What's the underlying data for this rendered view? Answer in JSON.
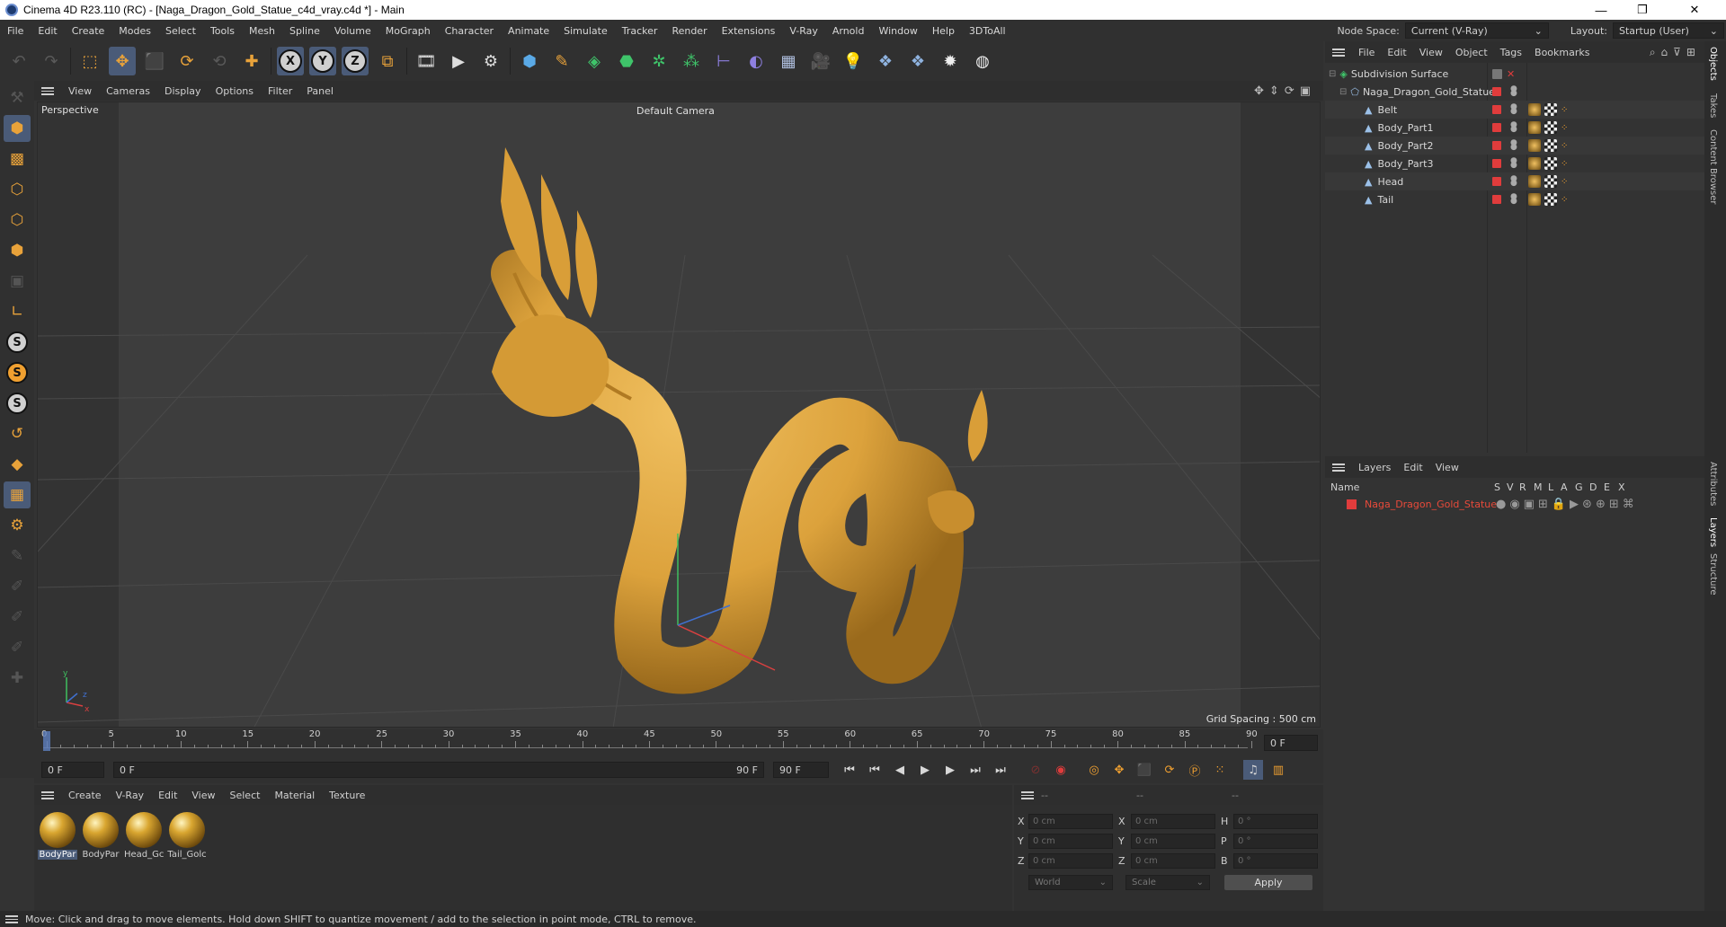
{
  "window": {
    "title": "Cinema 4D R23.110 (RC) - [Naga_Dragon_Gold_Statue_c4d_vray.c4d *] - Main",
    "minimize": "—",
    "maximize": "❐",
    "close": "✕"
  },
  "menu": [
    "File",
    "Edit",
    "Create",
    "Modes",
    "Select",
    "Tools",
    "Mesh",
    "Spline",
    "Volume",
    "MoGraph",
    "Character",
    "Animate",
    "Simulate",
    "Tracker",
    "Render",
    "Extensions",
    "V-Ray",
    "Arnold",
    "Window",
    "Help",
    "3DToAll"
  ],
  "node_space": {
    "label": "Node Space:",
    "value": "Current (V-Ray)"
  },
  "layout": {
    "label": "Layout:",
    "value": "Startup (User)"
  },
  "viewport_menu": [
    "View",
    "Cameras",
    "Display",
    "Options",
    "Filter",
    "Panel"
  ],
  "viewport": {
    "name": "Perspective",
    "camera": "Default Camera",
    "grid_spacing": "Grid Spacing : 500 cm"
  },
  "timeline": {
    "ticks": [
      "0",
      "5",
      "10",
      "15",
      "20",
      "25",
      "30",
      "35",
      "40",
      "45",
      "50",
      "55",
      "60",
      "65",
      "70",
      "75",
      "80",
      "85",
      "90"
    ],
    "current": "0 F"
  },
  "transport": {
    "start": "0 F",
    "range_start": "0 F",
    "range_end": "90 F",
    "end": "90 F"
  },
  "materials_menu": [
    "Create",
    "V-Ray",
    "Edit",
    "View",
    "Select",
    "Material",
    "Texture"
  ],
  "materials": [
    "BodyPar",
    "BodyPar",
    "Head_Gc",
    "Tail_Golc"
  ],
  "coords": {
    "header": [
      "--",
      "--",
      "--"
    ],
    "rows": [
      {
        "a": "X",
        "av": "0 cm",
        "b": "X",
        "bv": "0 cm",
        "c": "H",
        "cv": "0 °"
      },
      {
        "a": "Y",
        "av": "0 cm",
        "b": "Y",
        "bv": "0 cm",
        "c": "P",
        "cv": "0 °"
      },
      {
        "a": "Z",
        "av": "0 cm",
        "b": "Z",
        "bv": "0 cm",
        "c": "B",
        "cv": "0 °"
      }
    ],
    "space": "World",
    "mode": "Scale",
    "apply": "Apply"
  },
  "objects_menu": [
    "File",
    "Edit",
    "View",
    "Object",
    "Tags",
    "Bookmarks"
  ],
  "objects": [
    {
      "name": "Subdivision Surface",
      "level": 0
    },
    {
      "name": "Naga_Dragon_Gold_Statue",
      "level": 1
    },
    {
      "name": "Belt",
      "level": 2
    },
    {
      "name": "Body_Part1",
      "level": 2
    },
    {
      "name": "Body_Part2",
      "level": 2
    },
    {
      "name": "Body_Part3",
      "level": 2
    },
    {
      "name": "Head",
      "level": 2
    },
    {
      "name": "Tail",
      "level": 2
    }
  ],
  "layers_menu": [
    "Layers",
    "Edit",
    "View"
  ],
  "layers_header": {
    "name": "Name",
    "cols": [
      "S",
      "V",
      "R",
      "M",
      "L",
      "A",
      "G",
      "D",
      "E",
      "X"
    ]
  },
  "layers": [
    {
      "name": "Naga_Dragon_Gold_Statue"
    }
  ],
  "right_tabs": [
    "Objects",
    "Takes",
    "Content Browser",
    "Attributes",
    "Layers",
    "Structure"
  ],
  "status": "Move: Click and drag to move elements. Hold down SHIFT to quantize movement / add to the selection in point mode, CTRL to remove.",
  "colors": {
    "accent": "#4a5b78",
    "gold": "#e0a63c",
    "red": "#e03c3c"
  }
}
